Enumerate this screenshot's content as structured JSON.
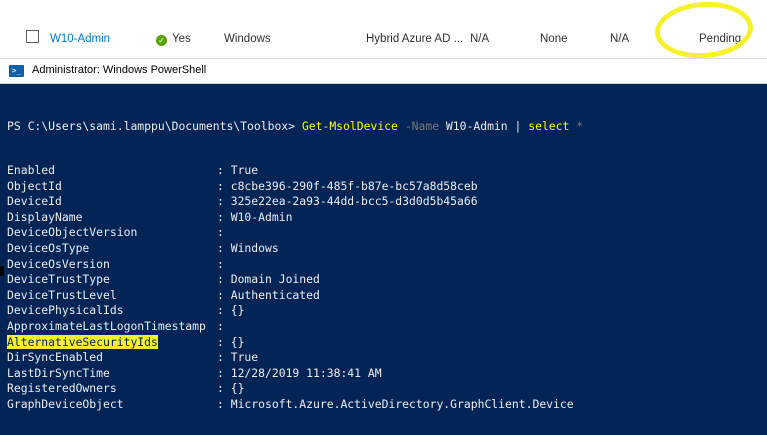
{
  "device_row": {
    "name": "W10-Admin",
    "enabled": "Yes",
    "os": "Windows",
    "join_type": "Hybrid Azure AD ...",
    "owner": "N/A",
    "mdm": "None",
    "compliant": "N/A",
    "registered": "Pending"
  },
  "powershell": {
    "window_title": "Administrator: Windows PowerShell",
    "prompt_path": "PS C:\\Users\\sami.lamppu\\Documents\\Toolbox>",
    "cmdlet": "Get-MsolDevice",
    "param": "-Name",
    "arg": "W10-Admin",
    "pipe": "|",
    "select_cmd": "select",
    "select_arg": "*",
    "properties": [
      {
        "name": "Enabled",
        "value": ": True"
      },
      {
        "name": "ObjectId",
        "value": ": c8cbe396-290f-485f-b87e-bc57a8d58ceb"
      },
      {
        "name": "DeviceId",
        "value": ": 325e22ea-2a93-44dd-bcc5-d3d0d5b45a66"
      },
      {
        "name": "DisplayName",
        "value": ": W10-Admin"
      },
      {
        "name": "DeviceObjectVersion",
        "value": ":"
      },
      {
        "name": "DeviceOsType",
        "value": ": Windows"
      },
      {
        "name": "DeviceOsVersion",
        "value": ":"
      },
      {
        "name": "DeviceTrustType",
        "value": ": Domain Joined"
      },
      {
        "name": "DeviceTrustLevel",
        "value": ": Authenticated"
      },
      {
        "name": "DevicePhysicalIds",
        "value": ": {}"
      },
      {
        "name": "ApproximateLastLogonTimestamp",
        "value": ":"
      },
      {
        "name": "AlternativeSecurityIds",
        "value": ": {}"
      },
      {
        "name": "DirSyncEnabled",
        "value": ": True"
      },
      {
        "name": "LastDirSyncTime",
        "value": ": 12/28/2019 11:38:41 AM"
      },
      {
        "name": "RegisteredOwners",
        "value": ": {}"
      },
      {
        "name": "GraphDeviceObject",
        "value": ": Microsoft.Azure.ActiveDirectory.GraphClient.Device"
      }
    ]
  },
  "colors": {
    "console_bg": "#012456",
    "console_text": "#eeedf0",
    "cmdlet": "#ffff00",
    "param": "#7a7a7a",
    "highlight": "#f5f22c",
    "link": "#0078d4",
    "status_ok": "#57a300"
  },
  "icons": {
    "status": "check-circle-icon",
    "powershell": "powershell-icon"
  }
}
